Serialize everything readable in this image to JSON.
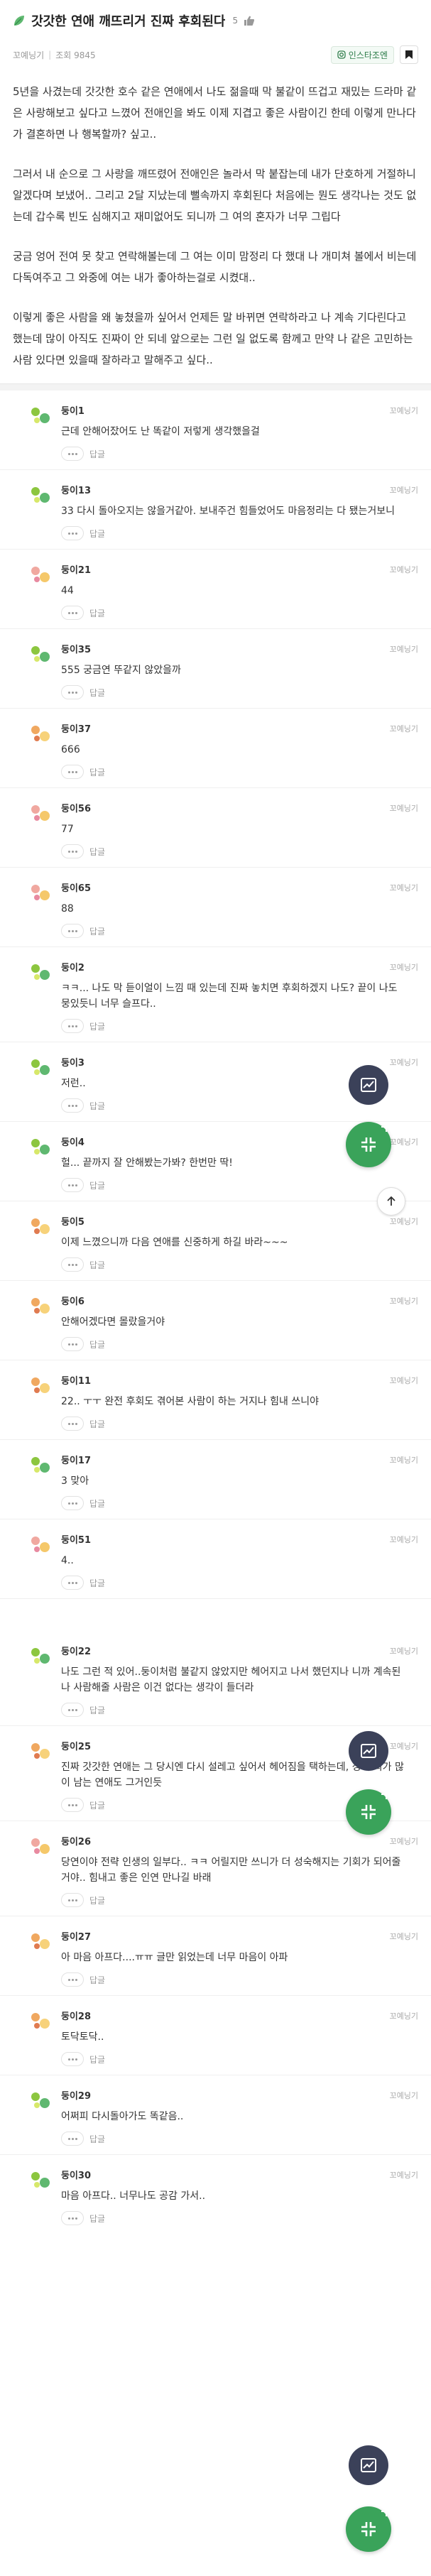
{
  "post": {
    "title": "갓갓한 연애 깨뜨리거 진짜 후회된다",
    "count": "5",
    "author": "꼬예닝기",
    "meta": "조회 9845",
    "insta_label": "인스타조엔",
    "paragraphs": [
      "5년을 사겼는데 갓갓한 호수 같은 연애에서 나도 젊을때 막 불같이 뜨겁고 재밌는 드라마 같은 사랑해보고 싶다고 느꼈어 전애인을 봐도 이제 지겹고 좋은 사람이긴 한데 이렇게 만나다가 결혼하면 나 행복할까? 싶고..",
      "그러서 내 순으로 그 사랑을 깨뜨렸어 전애인은 놀라서 막 붙잡는데 내가 단호하게 거절하니 알겠다며 보냈어.. 그리고 2달 지났는데 뻘속까지 후회된다 처음에는 뭔도 생각나는 것도 없는데 갑수록 빈도 심해지고 재미없어도 되니까 그 여의 혼자가 너무 그립다",
      "궁금 엉어 전여 못 찾고 연락해볼는데 그 여는 이미 맘정리 다 했대 나 개미쳐 볼에서 비는데 다독여주고 그 와중에 여는 내가 좋아하는걸로 시켰대..",
      "이렇게 좋은 사람을 왜 놓쳤을까 싶어서 언제든 말 바뀌면 연락하라고 나 계속 기다린다고 했는데 많이 아직도 진짜이 안 되네 앞으로는 그런 일 없도록 함께고 만약 나 같은 고민하는 사람 있다면 있을때 잘하라고 말해주고 싶다.."
    ]
  },
  "comments_a": [
    {
      "name": "둥이1",
      "time": "꼬예닝기",
      "text": "근데 안해어잤어도 난 똑같이 저렇게 생각했을걸",
      "reply": "답글",
      "avatar": "green"
    },
    {
      "name": "둥이13",
      "time": "꼬예닝기",
      "text": "33 다시 돌아오지는 않을거같아. 보내주건 힘들었어도 마음정리는 다 됐는거보니",
      "reply": "답글",
      "avatar": "green"
    },
    {
      "name": "둥이21",
      "time": "꼬예닝기",
      "text": "44",
      "reply": "답글",
      "avatar": "pink"
    },
    {
      "name": "둥이35",
      "time": "꼬예닝기",
      "text": "555 궁금연 뚜같지 않았을까",
      "reply": "답글",
      "avatar": "green"
    },
    {
      "name": "둥이37",
      "time": "꼬예닝기",
      "text": "666",
      "reply": "답글",
      "avatar": "orange"
    },
    {
      "name": "둥이56",
      "time": "꼬예닝기",
      "text": "77",
      "reply": "답글",
      "avatar": "pink"
    },
    {
      "name": "둥이65",
      "time": "꼬예닝기",
      "text": "88",
      "reply": "답글",
      "avatar": "pink"
    },
    {
      "name": "둥이2",
      "time": "꼬예닝기",
      "text": "ㅋㅋ... 나도 막 듣이얼이 느낌 때 있는데 진짜 놓치면 후회하겠지 나도? 끝이 나도 뭉있듯니 너무 슬프다..",
      "reply": "답글",
      "avatar": "green"
    },
    {
      "name": "둥이3",
      "time": "꼬예닝기",
      "text": "저런..",
      "reply": "답글",
      "avatar": "green"
    },
    {
      "name": "둥이4",
      "time": "꼬예닝기",
      "text": "헐... 끝까지 잘 안해봤는가봐? 한번만 딱!",
      "reply": "답글",
      "avatar": "green"
    },
    {
      "name": "둥이5",
      "time": "꼬예닝기",
      "text": "이제 느꼈으니까 다음 연애를 신중하게 하길 바라~~~",
      "reply": "답글",
      "avatar": "orange"
    },
    {
      "name": "둥이6",
      "time": "꼬예닝기",
      "text": "안해어겠다면 몰랐을거야",
      "reply": "답글",
      "avatar": "orange"
    },
    {
      "name": "둥이11",
      "time": "꼬예닝기",
      "text": "22.. ㅜㅜ 완전 후회도 겪어본 사람이 하는 거지나 힘내 쓰니야",
      "reply": "답글",
      "avatar": "orange"
    },
    {
      "name": "둥이17",
      "time": "꼬예닝기",
      "text": "3 맞아",
      "reply": "답글",
      "avatar": "green"
    },
    {
      "name": "둥이51",
      "time": "꼬예닝기",
      "text": "4..",
      "reply": "답글",
      "avatar": "pink"
    }
  ],
  "comments_b": [
    {
      "name": "둥이22",
      "time": "꼬예닝기",
      "text": "나도 그런 적 있어..둥이처럼 불같지 않았지만 헤어지고 나서 했던지나 니까 계속된 나 사람해줄 사람은 이건 없다는 생각이 들더라",
      "reply": "답글",
      "avatar": "green"
    },
    {
      "name": "둥이25",
      "time": "꼬예닝기",
      "text": "진짜 갓갓한 연애는 그 당시엔 다시 설레고 싶어서 헤어짐을 택하는데, 정 후회가 많이 남는 연애도 그거인듯",
      "reply": "답글",
      "avatar": "orange"
    },
    {
      "name": "둥이26",
      "time": "꼬예닝기",
      "text": "당연이야 전략 인생의 일부다.. ㅋㅋ 어릴지만 쓰니가 더 성숙해지는 기회가 되어줄거야.. 힘내고 좋은 인연 만나길 바래",
      "reply": "답글",
      "avatar": "pink"
    },
    {
      "name": "둥이27",
      "time": "꼬예닝기",
      "text": "아 마음 아프다....ㅠㅠ 글만 읽었는데 너무 마음이 아파",
      "reply": "답글",
      "avatar": "orange"
    },
    {
      "name": "둥이28",
      "time": "꼬예닝기",
      "text": "토닥토닥..",
      "reply": "답글",
      "avatar": "orange"
    },
    {
      "name": "둥이29",
      "time": "꼬예닝기",
      "text": "어쩌피 다시돌아가도 똑같음..",
      "reply": "답글",
      "avatar": "green"
    },
    {
      "name": "둥이30",
      "time": "꼬예닝기",
      "text": "마음 아프다.. 너무나도 공감 가서..",
      "reply": "답글",
      "avatar": "green"
    }
  ],
  "colors": {
    "accent": "#3aa35a",
    "fab_dark": "#3b4159",
    "avatar_green": "#8cc63f",
    "avatar_pink": "#f0a8a0",
    "avatar_orange": "#f0a860"
  },
  "icons": {
    "title": "leaf-icon",
    "likes": "thumb-icon",
    "insta": "instagram-icon",
    "bookmark": "bookmark-icon",
    "chart": "chart-icon",
    "collapse": "collapse-icon",
    "top": "arrow-up-icon",
    "more": "more-icon"
  }
}
